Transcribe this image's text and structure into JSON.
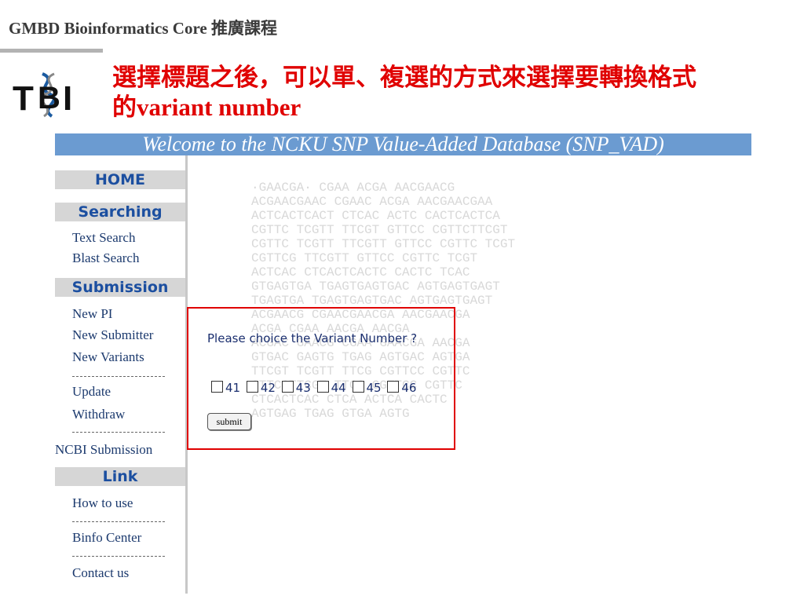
{
  "header": {
    "title": "GMBD Bioinformatics Core 推廣課程"
  },
  "logo": {
    "text": "TBI"
  },
  "slide": {
    "title_line1": "選擇標題之後，可以單、複選的方式來選擇要轉換格式",
    "title_line2": "的variant number"
  },
  "banner": {
    "text": "Welcome to the NCKU SNP Value-Added Database (SNP_VAD)"
  },
  "sidebar": {
    "home": "HOME",
    "searching": "Searching",
    "text_search": "Text Search",
    "blast_search": "Blast Search",
    "submission": "Submission",
    "new_pi": "New PI",
    "new_submitter": "New Submitter",
    "new_variants": "New Variants",
    "update": "Update",
    "withdraw": "Withdraw",
    "ncbi_submission": "NCBI Submission",
    "link": "Link",
    "how_to_use": "How to use",
    "binfo_center": "Binfo Center",
    "contact_us": "Contact us"
  },
  "watermark": {
    "rows": [
      "·GAACGA·   CGAA   ACGA   AACGAACG",
      "ACGAACGAAC  CGAAC  ACGA  AACGAACGAA",
      "ACTCACTCACT CTCAC  ACTC  CACTCACTCA",
      "CGTTC TCGTT TTCGT GTTCC  CGTTCTTCGT",
      "CGTTC TCGTT TTCGTT GTTCC CGTTC TCGT",
      "CGTTCG      TTCGTT GTTCC CGTTC TCGT",
      "ACTCAC      CTCACTCACTC  CACTC TCAC",
      "GTGAGTGA   TGAGTGAGTGAC AGTGAGTGAGT",
      "TGAGTGA    TGAGTGAGTGAC AGTGAGTGAGT",
      "  ACGAACG  CGAACGAACGA  AACGAACGA",
      "   ACGA    CGAA  AACGA   AACGA",
      "  ACGAC GAACG CGAA GAACGA AACGA",
      "  GTGAC GAGTG TGAG  AGTGAC AGTGA",
      "   TTCGT TCGTT TTCG CGTTCC CGTTC",
      "   GTTCGTTCGT TTCG  CGTTCC CGTTC",
      "   CTCACTCAC  CTCA  ACTCA  CACTC",
      "    AGTGAG     TGAG  GTGA   AGTG"
    ]
  },
  "form": {
    "question": "Please choice the Variant Number ?",
    "options": [
      "41",
      "42",
      "43",
      "44",
      "45",
      "46"
    ],
    "submit_label": "submit"
  }
}
